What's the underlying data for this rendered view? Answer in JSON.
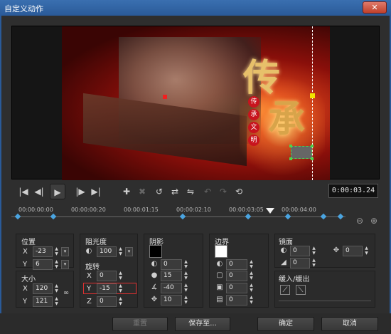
{
  "window": {
    "title": "自定义动作",
    "close_label": "✕"
  },
  "preview": {
    "title_char_1": "传",
    "title_char_2": "承",
    "seal_chars": [
      "传",
      "承",
      "文",
      "明"
    ]
  },
  "transport": {
    "timecode": "0:00:03.24"
  },
  "timeline": {
    "ticks": [
      "00:00:00:00",
      "00:00:00:20",
      "00:00:01:15",
      "00:00:02:10",
      "00:00:03:05",
      "00:00:04:00"
    ]
  },
  "position": {
    "label": "位置",
    "x_axis": "X",
    "x_value": "-23",
    "y_axis": "Y",
    "y_value": "6"
  },
  "size": {
    "label": "大小",
    "x_axis": "X",
    "x_value": "120",
    "y_axis": "Y",
    "y_value": "121"
  },
  "opacity": {
    "label": "阻光度",
    "value": "100"
  },
  "rotation": {
    "label": "旋转",
    "x_axis": "X",
    "x_value": "0",
    "y_axis": "Y",
    "y_value": "-15",
    "z_axis": "Z",
    "z_value": "0"
  },
  "shadow": {
    "label": "阴影",
    "color": "#000000",
    "values": [
      "0",
      "15",
      "-40",
      "10"
    ]
  },
  "border": {
    "label": "边界",
    "color": "#ffffff",
    "values": [
      "0",
      "0",
      "0",
      "0"
    ]
  },
  "mirror": {
    "label": "镜面",
    "values": [
      "0",
      "0"
    ],
    "offset_value": "0"
  },
  "ease": {
    "label": "缓入/缓出"
  },
  "buttons": {
    "reset": "重置",
    "save_to": "保存至...",
    "ok": "确定",
    "cancel": "取消"
  }
}
